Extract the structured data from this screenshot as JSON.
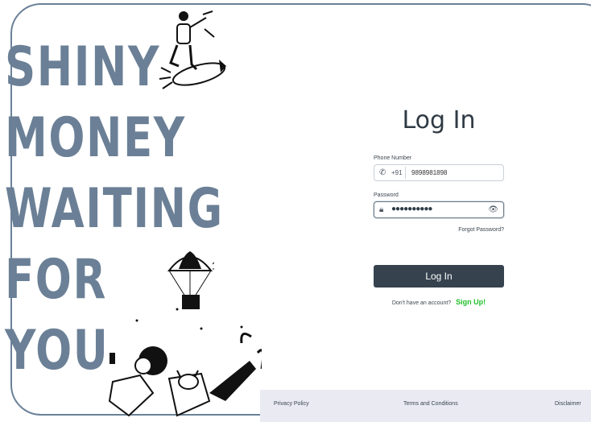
{
  "hero": {
    "lines": [
      "SHINY",
      "MONEY",
      "WAITING",
      "FOR",
      "YOU"
    ]
  },
  "login": {
    "title": "Log In",
    "phone_label": "Phone Number",
    "country_code": "+91",
    "phone_value": "9898981898",
    "password_label": "Password",
    "password_masked": "●●●●●●●●●●",
    "forgot_password": "Forgot Password?",
    "button": "Log In",
    "no_account": "Don't have an account?",
    "signup": "Sign Up!"
  },
  "footer": {
    "privacy": "Privacy Policy",
    "terms": "Terms and Conditions",
    "disclaimer": "Disclaimer"
  },
  "colors": {
    "hero_text": "#6b8096",
    "button": "#36434f",
    "signup": "#1fbf2a",
    "footer_bg": "#e9eaf2",
    "frame": "#6a8198"
  },
  "icons": [
    "rocket-rider-illustration",
    "parachute-box-illustration",
    "woman-with-dog-illustration",
    "phone-icon",
    "lock-icon",
    "eye-icon"
  ]
}
